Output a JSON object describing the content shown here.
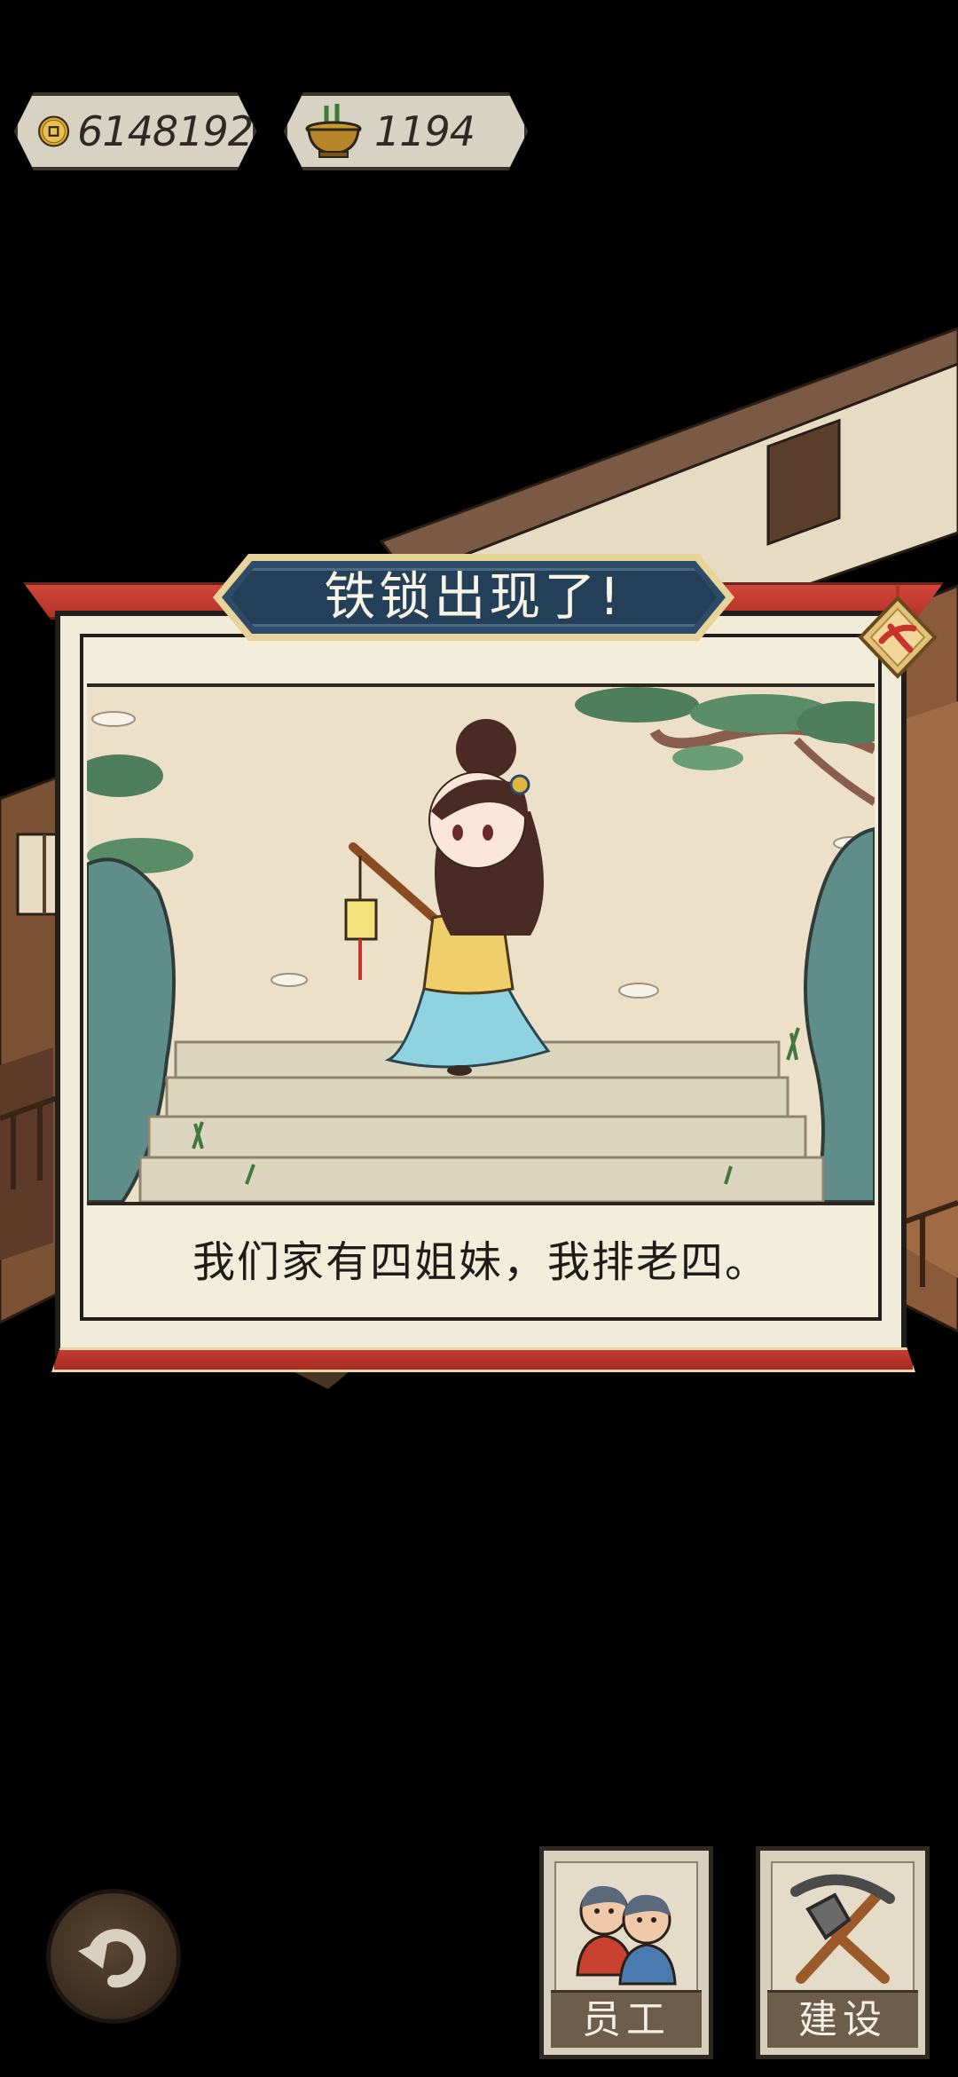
{
  "hud": {
    "coins": {
      "icon": "copper-coin-icon",
      "value": "6148192"
    },
    "incense": {
      "icon": "incense-burner-icon",
      "value": "1194"
    }
  },
  "dialog": {
    "title": "铁锁出现了!",
    "caption": "我们家有四姐妹，我排老四。",
    "close_icon": "close-badge-icon",
    "colors": {
      "banner": "#2d4a66",
      "ribbon": "#c43b31",
      "paper": "#f1ecd9"
    }
  },
  "bottom_bar": {
    "back_icon": "return-arrow-icon",
    "staff_label": "员工",
    "build_label": "建设"
  }
}
